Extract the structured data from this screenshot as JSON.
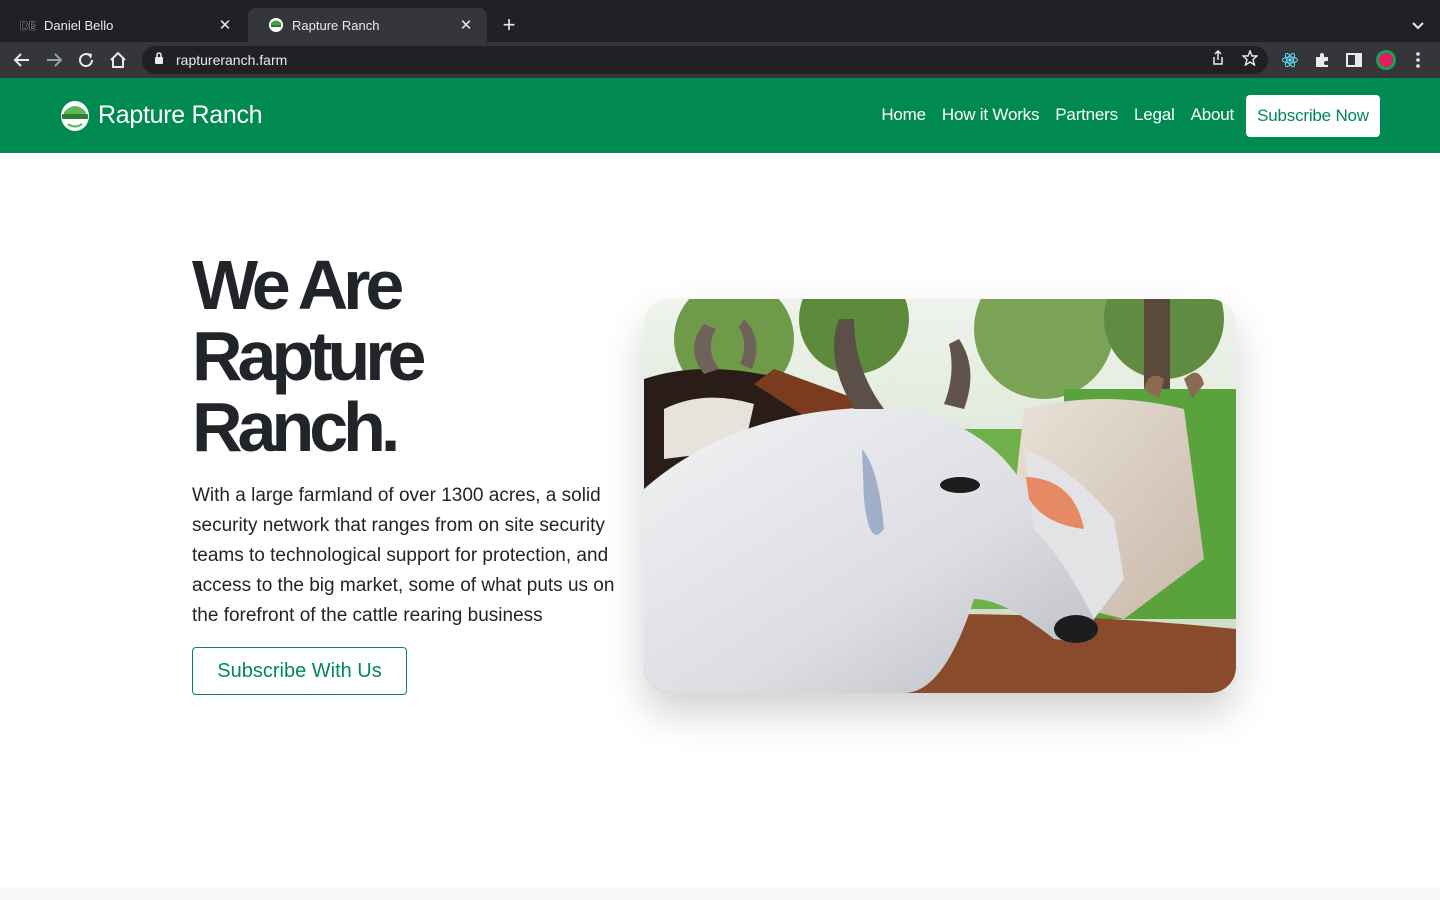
{
  "browser": {
    "tabs": [
      {
        "title": "Daniel Bello",
        "favicon": "DB",
        "active": false
      },
      {
        "title": "Rapture Ranch",
        "favicon": "rapture-ranch-logo",
        "active": true
      }
    ],
    "url": "raptureranch.farm"
  },
  "header": {
    "brand_name": "Rapture Ranch",
    "nav": [
      "Home",
      "How it Works",
      "Partners",
      "Legal",
      "About"
    ],
    "cta_label": "Subscribe Now"
  },
  "hero": {
    "title_lines": [
      "We Are",
      "Rapture",
      "Ranch."
    ],
    "description": "With a large farmland of over 1300 acres, a solid security network that ranges from on site security teams to technological support for protection, and access to the big market, some of what puts us on the forefront of the cattle rearing business",
    "cta_label": "Subscribe With Us",
    "image_subject": "white zebu cattle with horns in a green pasture"
  },
  "colors": {
    "brand_green": "#008a52",
    "text_dark": "#212529",
    "chrome_dark": "#202124",
    "chrome_toolbar": "#35363a"
  }
}
